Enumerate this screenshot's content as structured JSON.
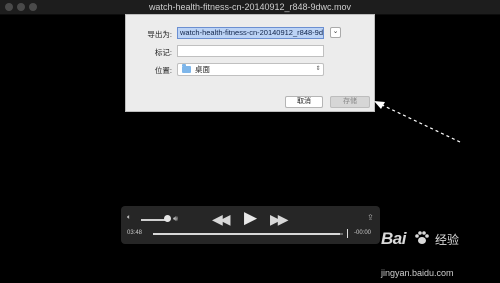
{
  "window": {
    "title": "watch-health-fitness-cn-20140912_r848-9dwc.mov"
  },
  "save_dialog": {
    "export_as_label": "导出为:",
    "export_as_value": "watch-health-fitness-cn-20140912_r848-9dwc",
    "tags_label": "标记:",
    "tags_value": "",
    "location_label": "位置:",
    "location_value": "桌面",
    "cancel_label": "取消",
    "save_label": "存储"
  },
  "player": {
    "time_elapsed": "03:48",
    "time_remaining": "-00:00",
    "progress": 0.985,
    "volume": 0.85
  },
  "watermark": {
    "logo_text": "Bai",
    "site_name": "经验",
    "url": "jingyan.baidu.com"
  },
  "icons": {
    "expand": "chevron-down-icon",
    "folder": "folder-icon",
    "rewind": "rewind-icon",
    "play": "play-icon",
    "fast_forward": "fast-forward-icon",
    "share": "share-icon",
    "volume_low": "volume-low-icon",
    "volume_high": "volume-high-icon"
  },
  "colors": {
    "selection": "#bcd3f5",
    "folder": "#7eb6ea",
    "background": "#000000"
  }
}
